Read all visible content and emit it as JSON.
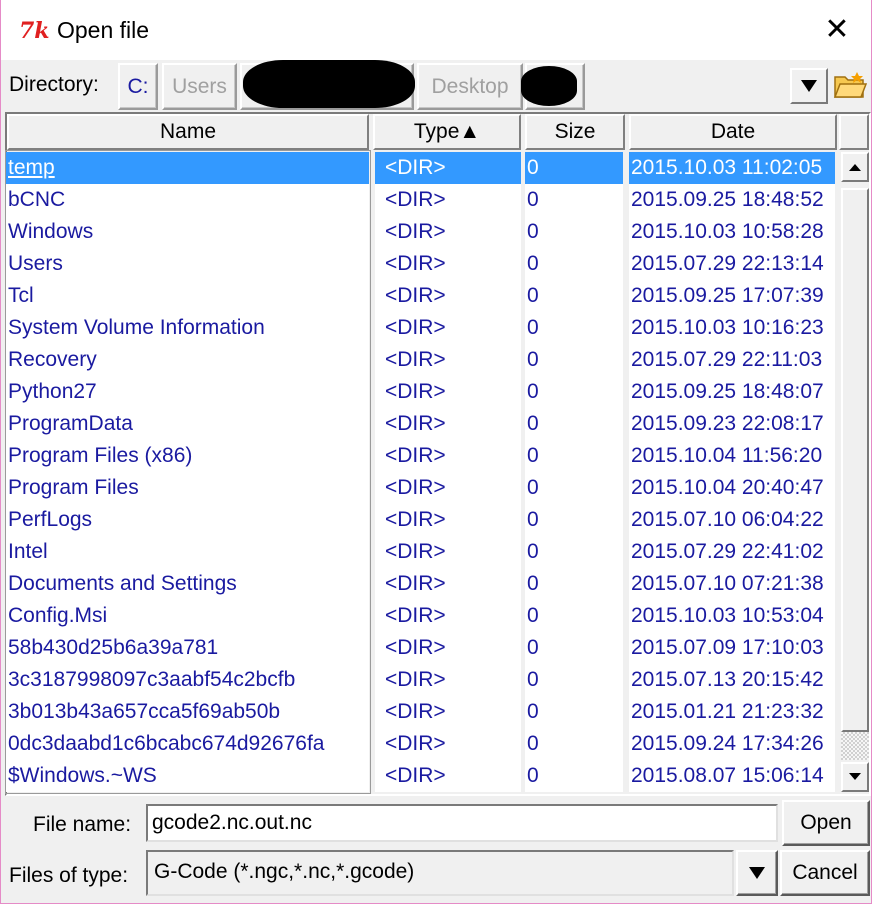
{
  "window": {
    "title": "Open file",
    "close_glyph": "✕"
  },
  "directory": {
    "label": "Directory:",
    "path_buttons": [
      "C:",
      "Users",
      "",
      "Desktop",
      ""
    ],
    "dropdown_icon": "triangle-down-icon",
    "new_folder_icon": "folder-icon"
  },
  "columns": {
    "name": "Name",
    "type": "Type▲",
    "size": "Size",
    "date": "Date"
  },
  "rows": [
    {
      "name": "temp",
      "type": "<DIR>",
      "size": "0",
      "date": "2015.10.03 11:02:05"
    },
    {
      "name": "bCNC",
      "type": "<DIR>",
      "size": "0",
      "date": "2015.09.25 18:48:52"
    },
    {
      "name": "Windows",
      "type": "<DIR>",
      "size": "0",
      "date": "2015.10.03 10:58:28"
    },
    {
      "name": "Users",
      "type": "<DIR>",
      "size": "0",
      "date": "2015.07.29 22:13:14"
    },
    {
      "name": "Tcl",
      "type": "<DIR>",
      "size": "0",
      "date": "2015.09.25 17:07:39"
    },
    {
      "name": "System Volume Information",
      "type": "<DIR>",
      "size": "0",
      "date": "2015.10.03 10:16:23"
    },
    {
      "name": "Recovery",
      "type": "<DIR>",
      "size": "0",
      "date": "2015.07.29 22:11:03"
    },
    {
      "name": "Python27",
      "type": "<DIR>",
      "size": "0",
      "date": "2015.09.25 18:48:07"
    },
    {
      "name": "ProgramData",
      "type": "<DIR>",
      "size": "0",
      "date": "2015.09.23 22:08:17"
    },
    {
      "name": "Program Files (x86)",
      "type": "<DIR>",
      "size": "0",
      "date": "2015.10.04 11:56:20"
    },
    {
      "name": "Program Files",
      "type": "<DIR>",
      "size": "0",
      "date": "2015.10.04 20:40:47"
    },
    {
      "name": "PerfLogs",
      "type": "<DIR>",
      "size": "0",
      "date": "2015.07.10 06:04:22"
    },
    {
      "name": "Intel",
      "type": "<DIR>",
      "size": "0",
      "date": "2015.07.29 22:41:02"
    },
    {
      "name": "Documents and Settings",
      "type": "<DIR>",
      "size": "0",
      "date": "2015.07.10 07:21:38"
    },
    {
      "name": "Config.Msi",
      "type": "<DIR>",
      "size": "0",
      "date": "2015.10.03 10:53:04"
    },
    {
      "name": "58b430d25b6a39a781",
      "type": "<DIR>",
      "size": "0",
      "date": "2015.07.09 17:10:03"
    },
    {
      "name": "3c3187998097c3aabf54c2bcfb",
      "type": "<DIR>",
      "size": "0",
      "date": "2015.07.13 20:15:42"
    },
    {
      "name": "3b013b43a657cca5f69ab50b",
      "type": "<DIR>",
      "size": "0",
      "date": "2015.01.21 21:23:32"
    },
    {
      "name": "0dc3daabd1c6bcabc674d92676fa",
      "type": "<DIR>",
      "size": "0",
      "date": "2015.09.24 17:34:26"
    },
    {
      "name": "$Windows.~WS",
      "type": "<DIR>",
      "size": "0",
      "date": "2015.08.07 15:06:14"
    }
  ],
  "selected_index": 0,
  "file_name": {
    "label": "File name:",
    "value": "gcode2.nc.out.nc"
  },
  "file_type": {
    "label": "Files of type:",
    "value": "G-Code (*.ngc,*.nc,*.gcode)"
  },
  "buttons": {
    "open": "Open",
    "cancel": "Cancel"
  },
  "colors": {
    "selection": "#3399ff",
    "list_text": "#1a1aa0",
    "tk_logo": "#e02020"
  }
}
